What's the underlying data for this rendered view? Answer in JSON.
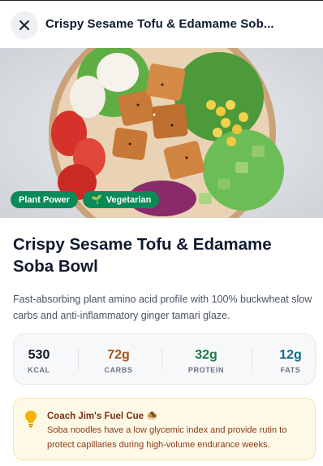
{
  "header": {
    "title": "Crispy Sesame Tofu & Edamame Sob..."
  },
  "hero": {
    "tags": [
      {
        "label": "Plant Power"
      },
      {
        "label": "Vegetarian",
        "icon": "sprout-icon"
      }
    ]
  },
  "recipe": {
    "title": "Crispy Sesame Tofu & Edamame Soba Bowl",
    "description": "Fast-absorbing plant amino acid profile with 100% buckwheat slow carbs and anti-inflammatory ginger tamari glaze."
  },
  "macros": [
    {
      "value": "530",
      "label": "KCAL",
      "color": "#111827"
    },
    {
      "value": "72g",
      "label": "CARBS",
      "color": "#a3561a"
    },
    {
      "value": "32g",
      "label": "PROTEIN",
      "color": "#1a7a4a"
    },
    {
      "value": "12g",
      "label": "FATS",
      "color": "#0f6b8a"
    }
  ],
  "coach": {
    "title": "Coach Jim's Fuel Cue 🧆",
    "text": "Soba noodles have a low glycemic index and provide rutin to protect capillaries during high-volume endurance weeks.",
    "icon": "lightbulb-icon"
  },
  "colors": {
    "accent_green": "#0a8a57",
    "title_navy": "#0f1a2e",
    "coach_bg": "#fef9e6"
  }
}
